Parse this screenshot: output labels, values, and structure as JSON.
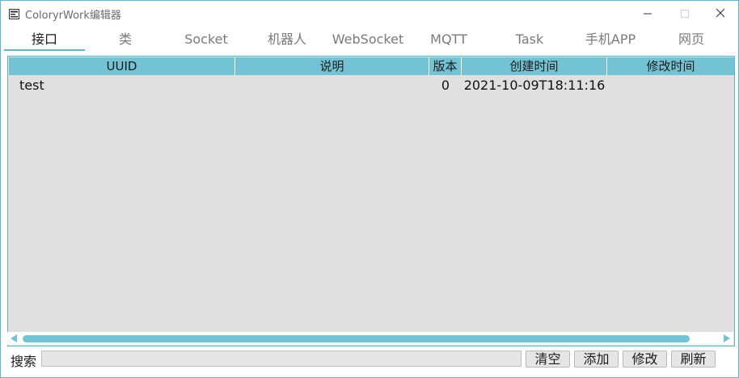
{
  "window": {
    "title": "ColoryrWork编辑器"
  },
  "tabs": [
    {
      "label": "接口",
      "active": true
    },
    {
      "label": "类"
    },
    {
      "label": "Socket"
    },
    {
      "label": "机器人"
    },
    {
      "label": "WebSocket"
    },
    {
      "label": "MQTT"
    },
    {
      "label": "Task"
    },
    {
      "label": "手机APP"
    },
    {
      "label": "网页"
    }
  ],
  "table": {
    "columns": [
      "UUID",
      "说明",
      "版本",
      "创建时间",
      "修改时间"
    ],
    "rows": [
      {
        "uuid": "test",
        "desc": "",
        "version": "0",
        "created": "2021-10-09T18:11:16",
        "modified": ""
      }
    ]
  },
  "search": {
    "label": "搜索",
    "value": ""
  },
  "buttons": {
    "clear": "清空",
    "add": "添加",
    "edit": "修改",
    "refresh": "刷新"
  },
  "colors": {
    "accent": "#74c3d4",
    "border": "#5fb6c8",
    "panel": "#e0e0e0"
  }
}
